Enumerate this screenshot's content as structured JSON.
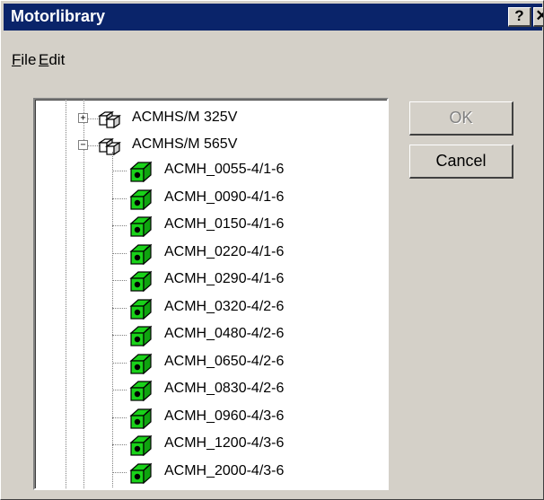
{
  "window": {
    "title": "Motorlibrary",
    "help_label": "?",
    "close_label": "✕"
  },
  "menu": [
    {
      "label": "File",
      "accel": "F",
      "rest": "ile"
    },
    {
      "label": "Edit",
      "accel": "E",
      "rest": "dit"
    }
  ],
  "tree": {
    "groups": [
      {
        "label": "ACMHS/M 325V",
        "expander": "+",
        "icon": "motor-group-icon"
      },
      {
        "label": "ACMHS/M 565V",
        "expander": "−",
        "icon": "motor-group-icon"
      }
    ],
    "children": [
      "ACMH_0055-4/1-6",
      "ACMH_0090-4/1-6",
      "ACMH_0150-4/1-6",
      "ACMH_0220-4/1-6",
      "ACMH_0290-4/1-6",
      "ACMH_0320-4/2-6",
      "ACMH_0480-4/2-6",
      "ACMH_0650-4/2-6",
      "ACMH_0830-4/2-6",
      "ACMH_0960-4/3-6",
      "ACMH_1200-4/3-6",
      "ACMH_2000-4/3-6"
    ],
    "child_icon": "motor-cube-icon"
  },
  "buttons": {
    "ok_label": "OK",
    "cancel_label": "Cancel"
  },
  "colors": {
    "titlebar": "#0a246a",
    "face": "#d4d0c8",
    "motor_green": "#19d219"
  }
}
